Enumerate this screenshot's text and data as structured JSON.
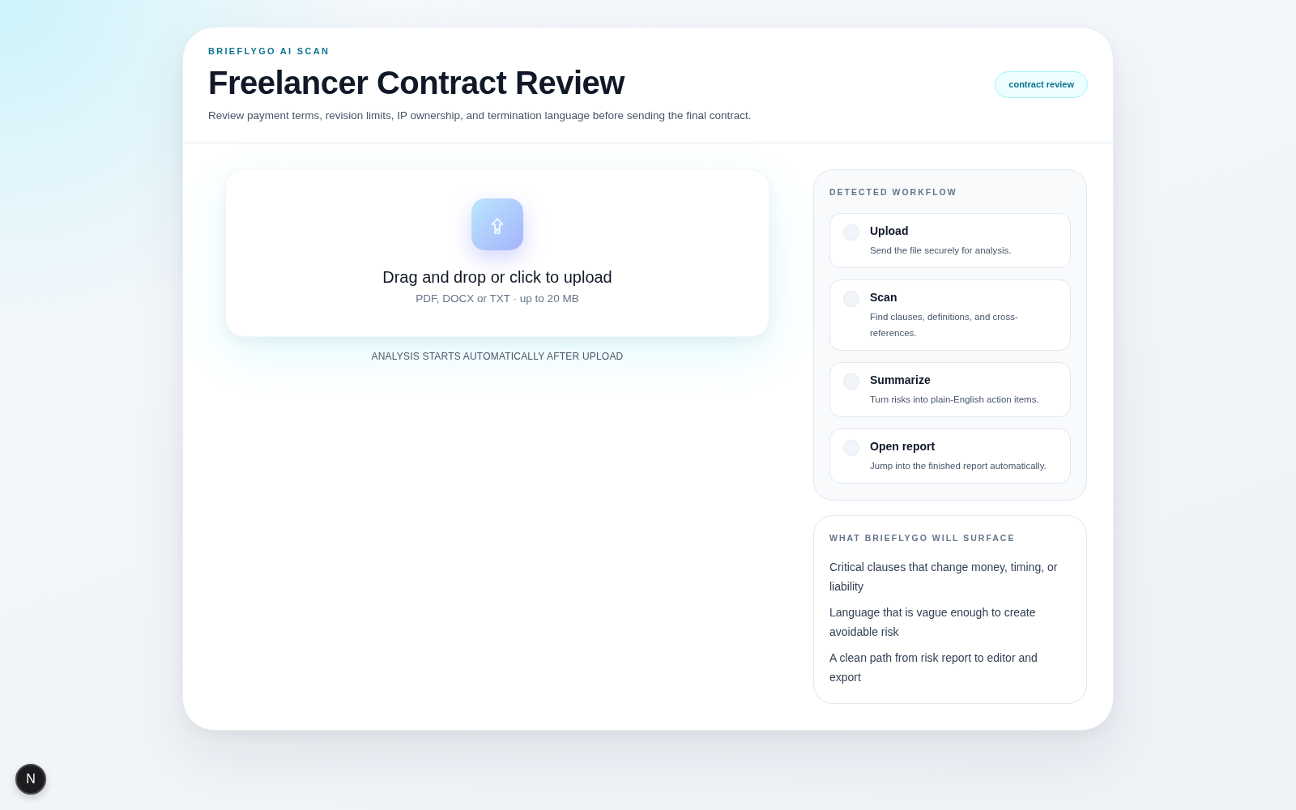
{
  "header": {
    "eyebrow": "BRIEFLYGO AI SCAN",
    "title": "Freelancer Contract Review",
    "subtitle": "Review payment terms, revision limits, IP ownership, and termination language before sending the final contract.",
    "tag": "contract review"
  },
  "upload": {
    "title": "Drag and drop or click to upload",
    "hint": "PDF, DOCX or TXT · up to 20 MB",
    "note": "ANALYSIS STARTS AUTOMATICALLY AFTER UPLOAD"
  },
  "workflow": {
    "heading": "DETECTED WORKFLOW",
    "steps": [
      {
        "title": "Upload",
        "description": "Send the file securely for analysis.",
        "completed": false
      },
      {
        "title": "Scan",
        "description": "Find clauses, definitions, and cross-references.",
        "completed": false
      },
      {
        "title": "Summarize",
        "description": "Turn risks into plain-English action items.",
        "completed": false
      },
      {
        "title": "Open report",
        "description": "Jump into the finished report automatically.",
        "completed": false
      }
    ]
  },
  "surface": {
    "heading": "WHAT BRIEFLYGO WILL SURFACE",
    "items": [
      "Critical clauses that change money, timing, or liability",
      "Language that is vague enough to create avoidable risk",
      "A clean path from risk report to editor and export"
    ]
  },
  "dev_indicator": {
    "label": "N"
  }
}
